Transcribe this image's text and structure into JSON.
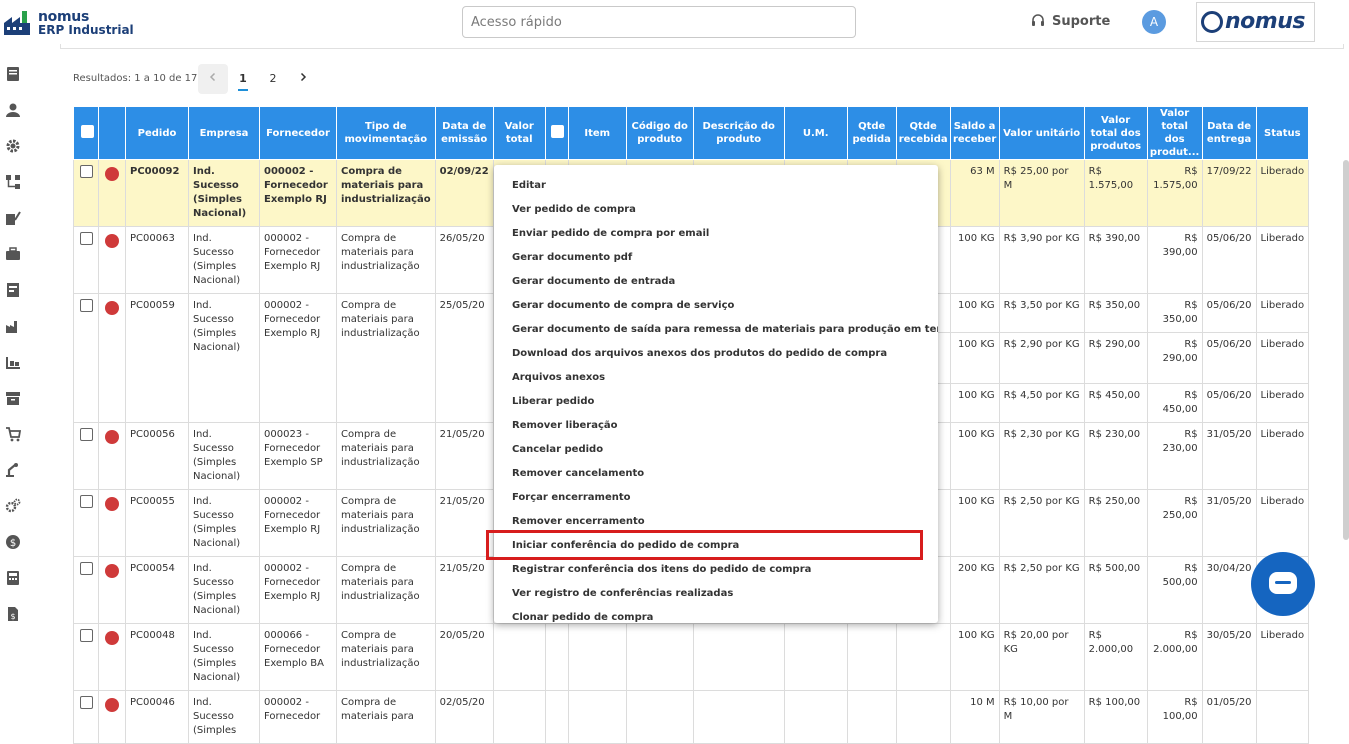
{
  "app": {
    "logo_line1": "nomus",
    "logo_line2": "ERP Industrial",
    "brand": "nomus"
  },
  "header": {
    "search_placeholder": "Acesso rápido",
    "support_label": "Suporte",
    "avatar_initial": "A"
  },
  "sidebar": {
    "icons": [
      "document-icon",
      "user-icon",
      "gear-icon",
      "workflow-icon",
      "tools-icon",
      "briefcase-icon",
      "report-icon",
      "factory-icon",
      "warehouse-icon",
      "archive-icon",
      "cart-icon",
      "robot-arm-icon",
      "cogs-icon",
      "dollar-icon",
      "calculator-icon",
      "file-dollar-icon"
    ]
  },
  "pagination": {
    "results_text": "Resultados: 1 a 10 de 17.",
    "pages": [
      "1",
      "2"
    ],
    "active_page": "1"
  },
  "table": {
    "headers": [
      "",
      "",
      "Pedido",
      "Empresa",
      "Fornecedor",
      "Tipo de movimentação",
      "Data de emissão",
      "Valor total",
      "",
      "Item",
      "Código do produto",
      "Descrição do produto",
      "U.M.",
      "Qtde pedida",
      "Qtde recebida",
      "Saldo a receber",
      "Valor unitário",
      "Valor total dos produtos",
      "Valor total dos produt...",
      "Data de entrega",
      "Status"
    ],
    "rows": [
      {
        "pedido": "PC00092",
        "empresa": "Ind. Sucesso (Simples Nacional)",
        "fornecedor": "000002 - Fornecedor Exemplo RJ",
        "tipo": "Compra de materiais para industrialização",
        "data": "02/09/22",
        "valor": "",
        "saldo": "63 M",
        "unit": "R$ 25,00 por M",
        "vtp": "R$ 1.575,00",
        "vtp2": "R$ 1.575,00",
        "entrega": "17/09/22",
        "status": "Liberado",
        "highlight": true
      },
      {
        "pedido": "PC00063",
        "empresa": "Ind. Sucesso (Simples Nacional)",
        "fornecedor": "000002 - Fornecedor Exemplo RJ",
        "tipo": "Compra de materiais para industrialização",
        "data": "26/05/20",
        "valor": "",
        "saldo": "100 KG",
        "unit": "R$ 3,90 por KG",
        "vtp": "R$ 390,00",
        "vtp2": "R$ 390,00",
        "entrega": "05/06/20",
        "status": "Liberado",
        "highlight": false
      },
      {
        "pedido": "PC00059",
        "empresa": "Ind. Sucesso (Simples Nacional)",
        "fornecedor": "000002 - Fornecedor Exemplo RJ",
        "tipo": "Compra de materiais para industrialização",
        "data": "25/05/20",
        "valor": "",
        "saldo": "100 KG",
        "unit": "R$ 3,50 por KG",
        "vtp": "R$ 350,00",
        "vtp2": "R$ 350,00",
        "entrega": "05/06/20",
        "status": "Liberado",
        "highlight": false
      },
      {
        "sub": true,
        "saldo": "100 KG",
        "unit": "R$ 2,90 por KG",
        "vtp": "R$ 290,00",
        "vtp2": "R$ 290,00",
        "entrega": "05/06/20",
        "status": "Liberado"
      },
      {
        "sub": true,
        "saldo": "100 KG",
        "unit": "R$ 4,50 por KG",
        "vtp": "R$ 450,00",
        "vtp2": "R$ 450,00",
        "entrega": "05/06/20",
        "status": "Liberado"
      },
      {
        "pedido": "PC00056",
        "empresa": "Ind. Sucesso (Simples Nacional)",
        "fornecedor": "000023 - Fornecedor Exemplo SP",
        "tipo": "Compra de materiais para industrialização",
        "data": "21/05/20",
        "valor": "",
        "saldo": "100 KG",
        "unit": "R$ 2,30 por KG",
        "vtp": "R$ 230,00",
        "vtp2": "R$ 230,00",
        "entrega": "31/05/20",
        "status": "Liberado",
        "highlight": false
      },
      {
        "pedido": "PC00055",
        "empresa": "Ind. Sucesso (Simples Nacional)",
        "fornecedor": "000002 - Fornecedor Exemplo RJ",
        "tipo": "Compra de materiais para industrialização",
        "data": "21/05/20",
        "valor": "",
        "saldo": "100 KG",
        "unit": "R$ 2,50 por KG",
        "vtp": "R$ 250,00",
        "vtp2": "R$ 250,00",
        "entrega": "31/05/20",
        "status": "Liberado",
        "highlight": false
      },
      {
        "pedido": "PC00054",
        "empresa": "Ind. Sucesso (Simples Nacional)",
        "fornecedor": "000002 - Fornecedor Exemplo RJ",
        "tipo": "Compra de materiais para industrialização",
        "data": "21/05/20",
        "valor": "",
        "saldo": "200 KG",
        "unit": "R$ 2,50 por KG",
        "vtp": "R$ 500,00",
        "vtp2": "R$ 500,00",
        "entrega": "30/04/20",
        "status": "Liberado",
        "highlight": false
      },
      {
        "pedido": "PC00048",
        "empresa": "Ind. Sucesso (Simples Nacional)",
        "fornecedor": "000066 - Fornecedor Exemplo BA",
        "tipo": "Compra de materiais para industrialização",
        "data": "20/05/20",
        "valor": "",
        "saldo": "100 KG",
        "unit": "R$ 20,00 por KG",
        "vtp": "R$ 2.000,00",
        "vtp2": "R$ 2.000,00",
        "entrega": "30/05/20",
        "status": "Liberado",
        "highlight": false
      },
      {
        "pedido": "PC00046",
        "empresa": "Ind. Sucesso (Simples",
        "fornecedor": "000002 - Fornecedor",
        "tipo": "Compra de materiais para",
        "data": "02/05/20",
        "valor": "",
        "saldo": "10 M",
        "unit": "R$ 10,00 por M",
        "vtp": "R$ 100,00",
        "vtp2": "R$ 100,00",
        "entrega": "01/05/20",
        "status": "",
        "highlight": false
      }
    ]
  },
  "context_menu": {
    "items": [
      "Editar",
      "Ver pedido de compra",
      "Enviar pedido de compra por email",
      "Gerar documento pdf",
      "Gerar documento de entrada",
      "Gerar documento de compra de serviço",
      "Gerar documento de saída para remessa de materiais para produção em terceiros",
      "Download dos arquivos anexos dos produtos do pedido de compra",
      "Arquivos anexos",
      "Liberar pedido",
      "Remover liberação",
      "Cancelar pedido",
      "Remover cancelamento",
      "Forçar encerramento",
      "Remover encerramento",
      "Iniciar conferência do pedido de compra",
      "Registrar conferência dos itens do pedido de compra",
      "Ver registro de conferências realizadas",
      "Clonar pedido de compra"
    ],
    "highlighted_index": 15
  },
  "colors": {
    "header_blue": "#2d8ee6",
    "highlight_row": "#fdf7c8",
    "status_dot": "#cf3a3a",
    "annotation_red": "#d71d1d"
  }
}
